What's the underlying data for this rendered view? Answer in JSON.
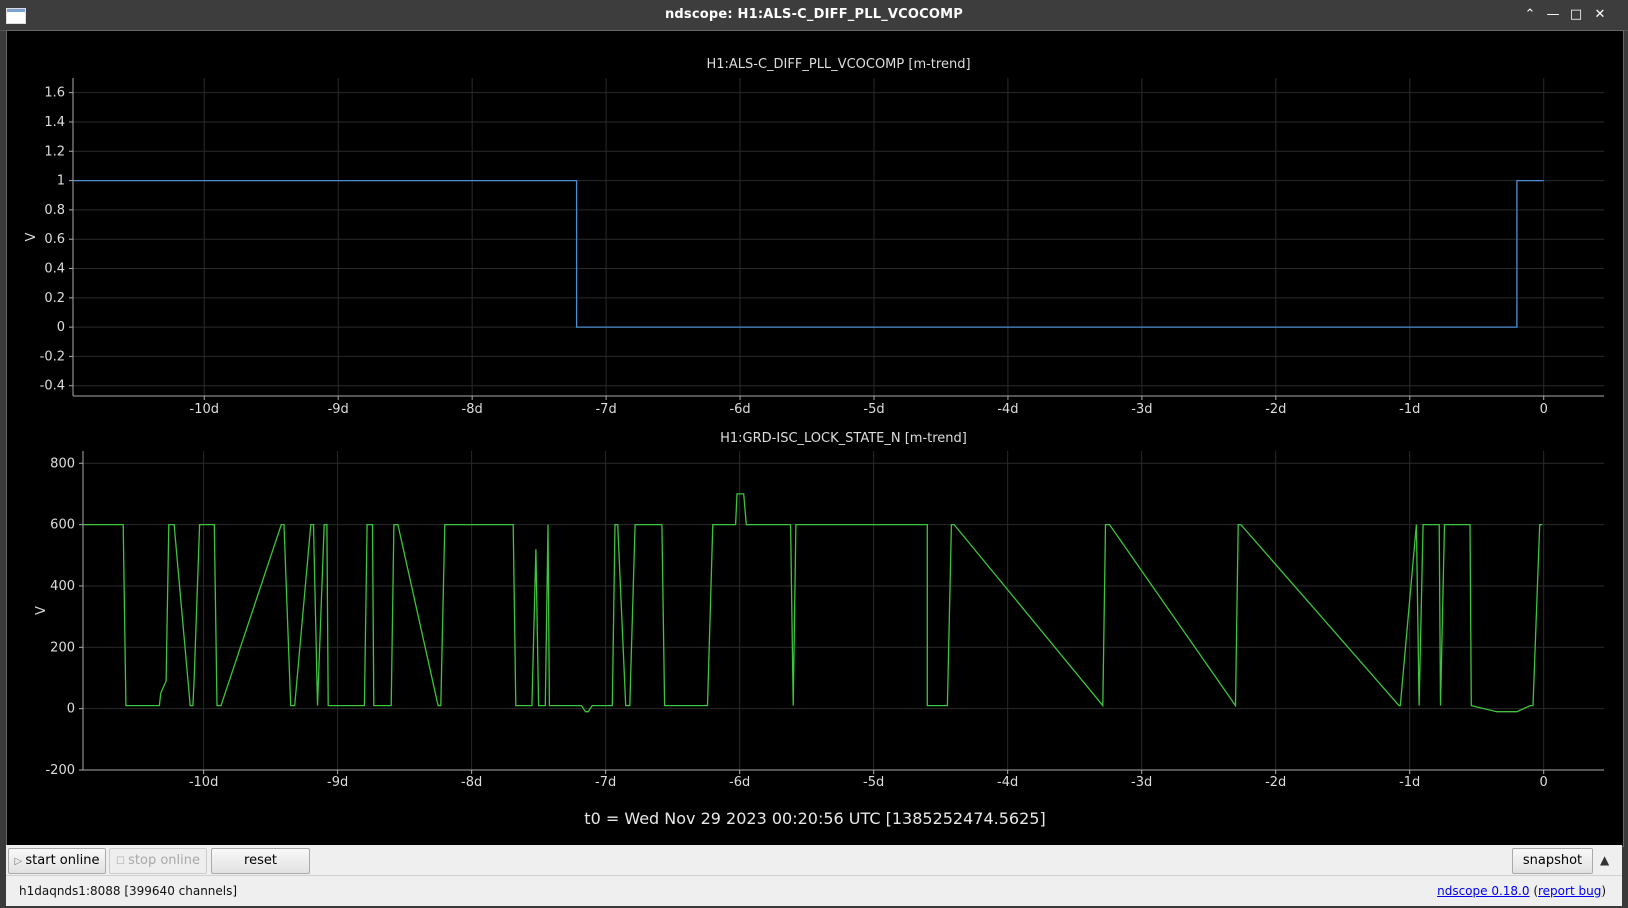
{
  "window": {
    "title": "ndscope: H1:ALS-C_DIFF_PLL_VCOCOMP",
    "buttons": [
      "⌃",
      "—",
      "□",
      "✕"
    ]
  },
  "plots": [
    {
      "title": "H1:ALS-C_DIFF_PLL_VCOCOMP [m-trend]",
      "ylabel": "V",
      "color": "#4a8fd4",
      "yticks": [
        "1.6",
        "1.4",
        "1.2",
        "1",
        "0.8",
        "0.6",
        "0.4",
        "0.2",
        "0",
        "-0.2",
        "-0.4"
      ],
      "xticks": [
        "-10d",
        "-9d",
        "-8d",
        "-7d",
        "-6d",
        "-5d",
        "-4d",
        "-3d",
        "-2d",
        "-1d",
        "0"
      ]
    },
    {
      "title": "H1:GRD-ISC_LOCK_STATE_N [m-trend]",
      "ylabel": "V",
      "color": "#3cc43c",
      "yticks": [
        "800",
        "600",
        "400",
        "200",
        "0",
        "-200"
      ],
      "xticks": [
        "-10d",
        "-9d",
        "-8d",
        "-7d",
        "-6d",
        "-5d",
        "-4d",
        "-3d",
        "-2d",
        "-1d",
        "0"
      ]
    }
  ],
  "chart_data": [
    {
      "type": "line",
      "title": "H1:ALS-C_DIFF_PLL_VCOCOMP [m-trend]",
      "xlabel": "",
      "ylabel": "V",
      "xlim_days": [
        -10.98,
        0.45
      ],
      "ylim": [
        -0.47,
        1.7
      ],
      "grid": true,
      "series": [
        {
          "x": [
            -10.98,
            -7.22,
            -7.22,
            -0.2,
            -0.2,
            0.0
          ],
          "y": [
            1,
            1,
            0,
            0,
            1,
            1
          ]
        }
      ]
    },
    {
      "type": "line",
      "title": "H1:GRD-ISC_LOCK_STATE_N [m-trend]",
      "xlabel": "",
      "ylabel": "V",
      "xlim_days": [
        -10.9,
        0.45
      ],
      "ylim": [
        -200,
        840
      ],
      "grid": true,
      "series": [
        {
          "x": [
            -10.9,
            -10.6,
            -10.58,
            -10.33,
            -10.32,
            -10.28,
            -10.26,
            -10.22,
            -10.1,
            -10.08,
            -10.07,
            -10.03,
            -9.92,
            -9.9,
            -9.87,
            -9.42,
            -9.4,
            -9.35,
            -9.32,
            -9.2,
            -9.18,
            -9.15,
            -9.1,
            -9.08,
            -9.07,
            -8.8,
            -8.78,
            -8.74,
            -8.73,
            -8.6,
            -8.58,
            -8.55,
            -8.25,
            -8.23,
            -8.2,
            -7.69,
            -7.67,
            -7.55,
            -7.52,
            -7.5,
            -7.45,
            -7.43,
            -7.42,
            -7.35,
            -7.18,
            -7.15,
            -7.13,
            -7.1,
            -7.05,
            -6.95,
            -6.93,
            -6.91,
            -6.85,
            -6.82,
            -6.78,
            -6.58,
            -6.56,
            -6.52,
            -6.48,
            -6.24,
            -6.2,
            -6.18,
            -6.05,
            -6.03,
            -6.02,
            -5.97,
            -5.95,
            -5.62,
            -5.6,
            -5.58,
            -4.6,
            -4.6,
            -4.45,
            -4.42,
            -4.4,
            -3.29,
            -3.27,
            -3.24,
            -2.3,
            -2.28,
            -2.26,
            -1.08,
            -1.07,
            -0.95,
            -0.93,
            -0.9,
            -0.78,
            -0.77,
            -0.74,
            -0.55,
            -0.54,
            -0.35,
            -0.2,
            -0.1,
            -0.08,
            -0.03,
            -0.01
          ],
          "y": [
            600,
            600,
            10,
            10,
            50,
            90,
            600,
            600,
            10,
            10,
            100,
            600,
            600,
            10,
            10,
            600,
            600,
            10,
            10,
            600,
            600,
            10,
            600,
            600,
            10,
            10,
            600,
            600,
            10,
            10,
            600,
            600,
            10,
            10,
            600,
            600,
            10,
            10,
            520,
            10,
            10,
            600,
            10,
            10,
            10,
            -10,
            -10,
            10,
            10,
            10,
            600,
            600,
            10,
            10,
            600,
            600,
            10,
            10,
            10,
            10,
            600,
            600,
            600,
            600,
            700,
            700,
            600,
            600,
            10,
            600,
            600,
            10,
            10,
            600,
            600,
            10,
            600,
            600,
            10,
            600,
            600,
            10,
            10,
            600,
            10,
            600,
            600,
            10,
            600,
            600,
            10,
            -10,
            -10,
            10,
            10,
            600,
            600
          ]
        }
      ]
    }
  ],
  "t0_label": "t0 = Wed Nov 29 2023 00:20:56 UTC [1385252474.5625]",
  "toolbar": {
    "start_online": "start online",
    "stop_online": "stop online",
    "reset": "reset",
    "snapshot": "snapshot"
  },
  "status": {
    "server": "h1daqnds1:8088  [399640 channels]",
    "version_link": "ndscope 0.18.0",
    "report_bug": "report bug"
  }
}
